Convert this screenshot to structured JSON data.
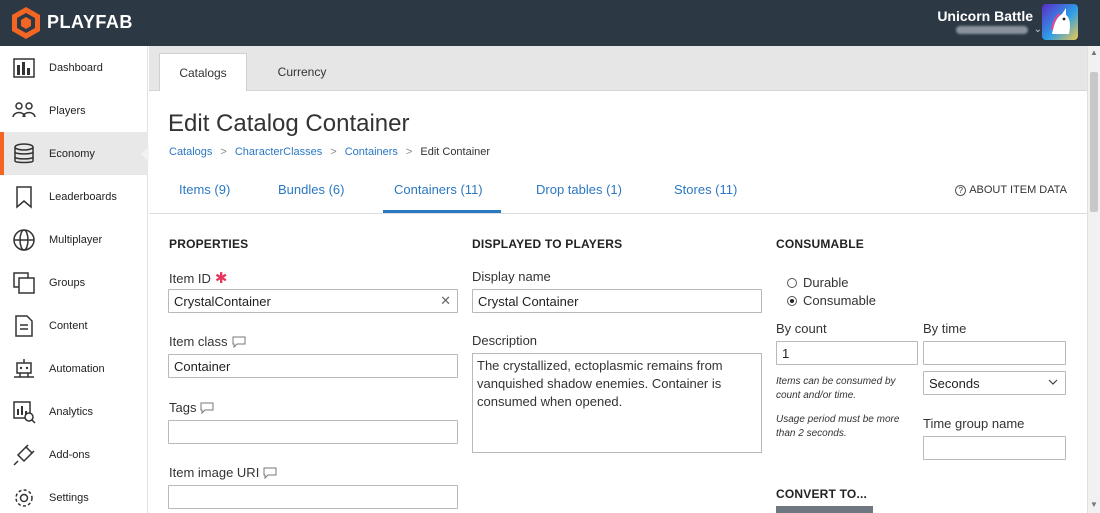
{
  "topbar": {
    "brand": "PLAYFAB",
    "studio_name": "Unicorn Battle",
    "logo_icon": "playfab-logo-icon",
    "accent": "#f26522",
    "bg": "#2c3844"
  },
  "sidebar": {
    "items": [
      {
        "label": "Dashboard",
        "icon": "bar-chart-icon"
      },
      {
        "label": "Players",
        "icon": "people-icon"
      },
      {
        "label": "Economy",
        "icon": "coin-stack-icon"
      },
      {
        "label": "Leaderboards",
        "icon": "bookmark-icon"
      },
      {
        "label": "Multiplayer",
        "icon": "globe-icon"
      },
      {
        "label": "Groups",
        "icon": "stacked-windows-icon"
      },
      {
        "label": "Content",
        "icon": "document-icon"
      },
      {
        "label": "Automation",
        "icon": "robot-icon"
      },
      {
        "label": "Analytics",
        "icon": "analytics-icon"
      },
      {
        "label": "Add-ons",
        "icon": "plug-icon"
      },
      {
        "label": "Settings",
        "icon": "gear-icon"
      }
    ],
    "active": "Economy"
  },
  "top_tabs": [
    {
      "label": "Catalogs",
      "active": true
    },
    {
      "label": "Currency",
      "active": false
    }
  ],
  "page": {
    "title": "Edit Catalog Container",
    "breadcrumb": [
      "Catalogs",
      "CharacterClasses",
      "Containers",
      "Edit Container"
    ],
    "breadcrumb_sep": ">"
  },
  "sub_tabs": [
    {
      "label": "Items (9)",
      "active": false
    },
    {
      "label": "Bundles (6)",
      "active": false
    },
    {
      "label": "Containers (11)",
      "active": true
    },
    {
      "label": "Drop tables (1)",
      "active": false
    },
    {
      "label": "Stores (11)",
      "active": false
    }
  ],
  "about_link": "ABOUT ITEM DATA",
  "properties": {
    "heading": "PROPERTIES",
    "item_id_label": "Item ID",
    "item_id_value": "CrystalContainer",
    "item_class_label": "Item class",
    "item_class_value": "Container",
    "tags_label": "Tags",
    "tags_value": "",
    "image_uri_label": "Item image URI",
    "image_uri_value": ""
  },
  "displayed": {
    "heading": "DISPLAYED TO PLAYERS",
    "display_name_label": "Display name",
    "display_name_value": "Crystal Container",
    "description_label": "Description",
    "description_value": "The crystallized, ectoplasmic remains from vanquished shadow enemies. Container is consumed when opened."
  },
  "consumable": {
    "heading": "CONSUMABLE",
    "options": [
      {
        "label": "Durable",
        "selected": false
      },
      {
        "label": "Consumable",
        "selected": true
      }
    ],
    "by_count_label": "By count",
    "by_count_value": "1",
    "by_time_label": "By time",
    "by_time_value": "",
    "note1": "Items can be consumed by count and/or time.",
    "note2": "Usage period must be more than 2 seconds.",
    "time_unit": "Seconds",
    "time_group_label": "Time group name",
    "time_group_value": ""
  },
  "convert": {
    "heading": "CONVERT TO..."
  }
}
